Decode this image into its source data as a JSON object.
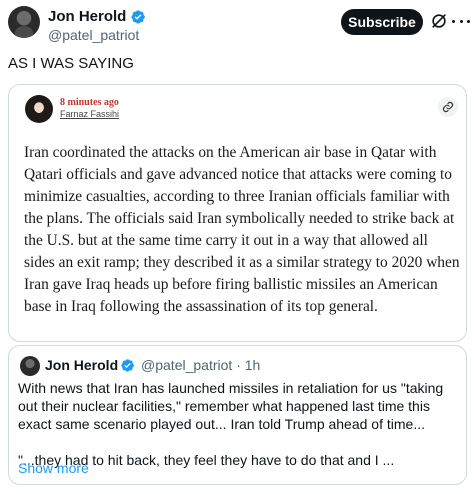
{
  "author": {
    "name": "Jon Herold",
    "handle": "@patel_patriot"
  },
  "actions": {
    "subscribe_label": "Subscribe"
  },
  "post": {
    "text": "AS I WAS SAYING"
  },
  "article": {
    "time": "8 minutes ago",
    "author": "Farnaz Fassihi",
    "body": "Iran coordinated the attacks on the American air base in Qatar with Qatari officials and gave advanced notice that attacks were coming to minimize casualties, according to three Iranian officials familiar with the plans. The officials said Iran symbolically needed to strike back at the U.S. but at the same time carry it out in a way that allowed all sides an exit ramp; they described it as a similar strategy to 2020 when Iran gave Iraq heads up before firing ballistic missiles an American base in Iraq following the assassination of its top general."
  },
  "quote": {
    "name": "Jon Herold",
    "handle": "@patel_patriot",
    "separator": "·",
    "time": "1h",
    "paragraph1": "With news that Iran has launched missiles in retaliation for us \"taking out their nuclear facilities,\" remember what happened last time this exact same scenario played out... Iran told Trump ahead of time...",
    "paragraph2": "\"...they had to hit back, they feel they have to do that and I ...",
    "show_more": "Show more"
  },
  "colors": {
    "verified": "#1d9bf0",
    "link": "#1d9bf0",
    "article_time": "#c2372f"
  }
}
